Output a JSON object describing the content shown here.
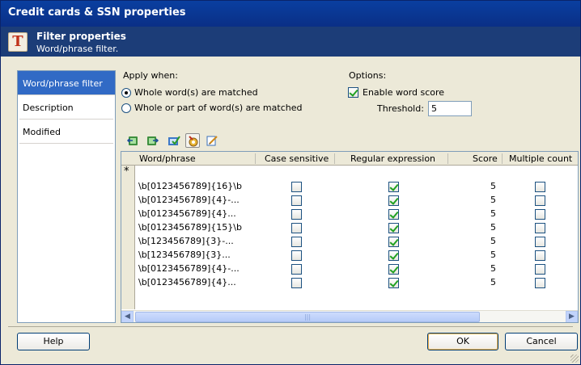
{
  "window": {
    "title": "Credit cards & SSN properties"
  },
  "header": {
    "icon": "text-filter-icon",
    "icon_glyph": "T",
    "title": "Filter properties",
    "subtitle": "Word/phrase filter."
  },
  "nav": {
    "items": [
      {
        "label": "Word/phrase filter",
        "active": true
      },
      {
        "label": "Description",
        "active": false
      },
      {
        "label": "Modified",
        "active": false
      }
    ]
  },
  "apply_when": {
    "label": "Apply when:",
    "options": [
      {
        "label": "Whole word(s) are matched",
        "selected": true
      },
      {
        "label": "Whole or part of word(s) are matched",
        "selected": false
      }
    ]
  },
  "options": {
    "label": "Options:",
    "enable_word_score": {
      "label": "Enable word score",
      "checked": true
    },
    "threshold": {
      "label": "Threshold:",
      "value": "5"
    }
  },
  "toolbar": {
    "icons": [
      "import-icon",
      "export-icon",
      "validate-icon",
      "filter-settings-icon",
      "edit-icon"
    ]
  },
  "grid": {
    "columns": [
      "Word/phrase",
      "Case sensitive",
      "Regular expression",
      "Score",
      "Multiple count"
    ],
    "new_row_marker": "*",
    "rows": [
      {
        "phrase": "\\b[0123456789]{16}\\b",
        "case_sensitive": false,
        "regex": true,
        "score": "5",
        "multiple": false
      },
      {
        "phrase": "\\b[0123456789]{4}-...",
        "case_sensitive": false,
        "regex": true,
        "score": "5",
        "multiple": false
      },
      {
        "phrase": "\\b[0123456789]{4}...",
        "case_sensitive": false,
        "regex": true,
        "score": "5",
        "multiple": false
      },
      {
        "phrase": "\\b[0123456789]{15}\\b",
        "case_sensitive": false,
        "regex": true,
        "score": "5",
        "multiple": false
      },
      {
        "phrase": "\\b[123456789]{3}-...",
        "case_sensitive": false,
        "regex": true,
        "score": "5",
        "multiple": false
      },
      {
        "phrase": "\\b[123456789]{3}...",
        "case_sensitive": false,
        "regex": true,
        "score": "5",
        "multiple": false
      },
      {
        "phrase": "\\b[0123456789]{4}-...",
        "case_sensitive": false,
        "regex": true,
        "score": "5",
        "multiple": false
      },
      {
        "phrase": "\\b[0123456789]{4}...",
        "case_sensitive": false,
        "regex": true,
        "score": "5",
        "multiple": false
      }
    ]
  },
  "buttons": {
    "help": "Help",
    "ok": "OK",
    "cancel": "Cancel"
  },
  "colors": {
    "titlebar": "#0a3fa0",
    "header": "#1c3d78",
    "selection": "#316ac5",
    "check": "#21a121"
  }
}
